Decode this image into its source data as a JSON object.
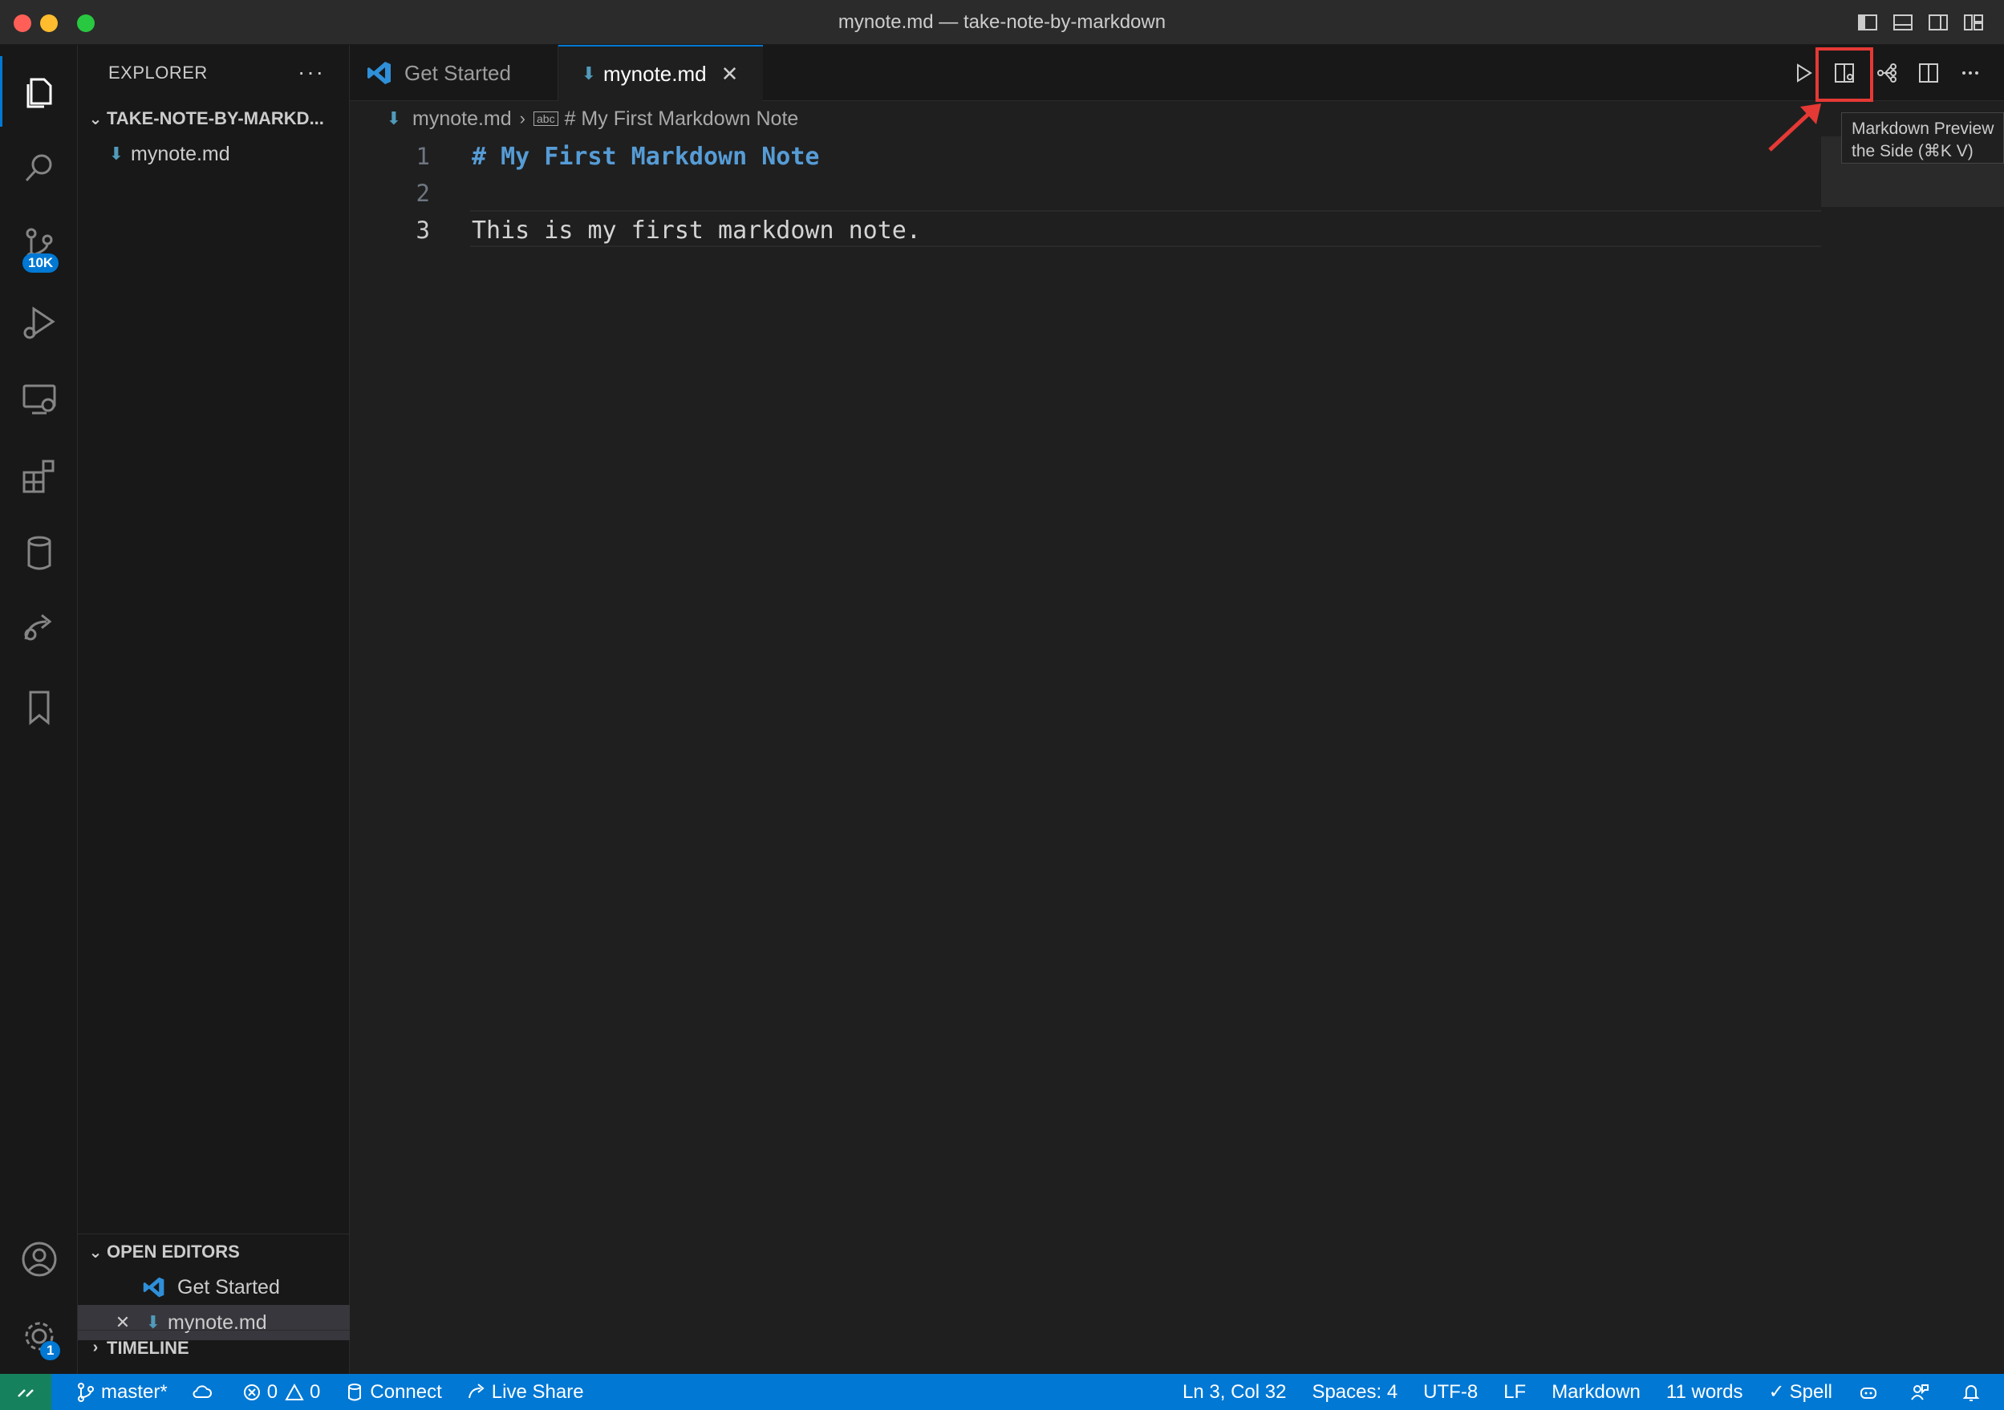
{
  "window": {
    "title": "mynote.md — take-note-by-markdown"
  },
  "activity_bar": {
    "source_control_badge": "10K",
    "settings_badge": "1"
  },
  "sidebar": {
    "title": "EXPLORER",
    "more": "···",
    "folder_name": "TAKE-NOTE-BY-MARKD...",
    "files": [
      "mynote.md"
    ],
    "open_editors": {
      "title": "OPEN EDITORS",
      "items": [
        "Get Started",
        "mynote.md"
      ]
    },
    "timeline_title": "TIMELINE"
  },
  "tabs": [
    {
      "label": "Get Started"
    },
    {
      "label": "mynote.md"
    }
  ],
  "breadcrumb": {
    "file": "mynote.md",
    "symbol": "# My First Markdown Note"
  },
  "editor": {
    "lines": [
      {
        "number": "1",
        "text": "# My First Markdown Note"
      },
      {
        "number": "2",
        "text": ""
      },
      {
        "number": "3",
        "text": "This is my first markdown note."
      }
    ]
  },
  "tooltip": {
    "line1": "Markdown Preview",
    "line2": "the Side (⌘K V)"
  },
  "statusbar": {
    "branch": "master*",
    "errors": "0",
    "warnings": "0",
    "connect": "Connect",
    "live_share": "Live Share",
    "position": "Ln 3, Col 32",
    "spaces": "Spaces: 4",
    "encoding": "UTF-8",
    "eol": "LF",
    "language": "Markdown",
    "words": "11 words",
    "spell": "Spell"
  },
  "colors": {
    "accent": "#0078d4",
    "highlight": "#e53935",
    "heading": "#569cd6"
  }
}
